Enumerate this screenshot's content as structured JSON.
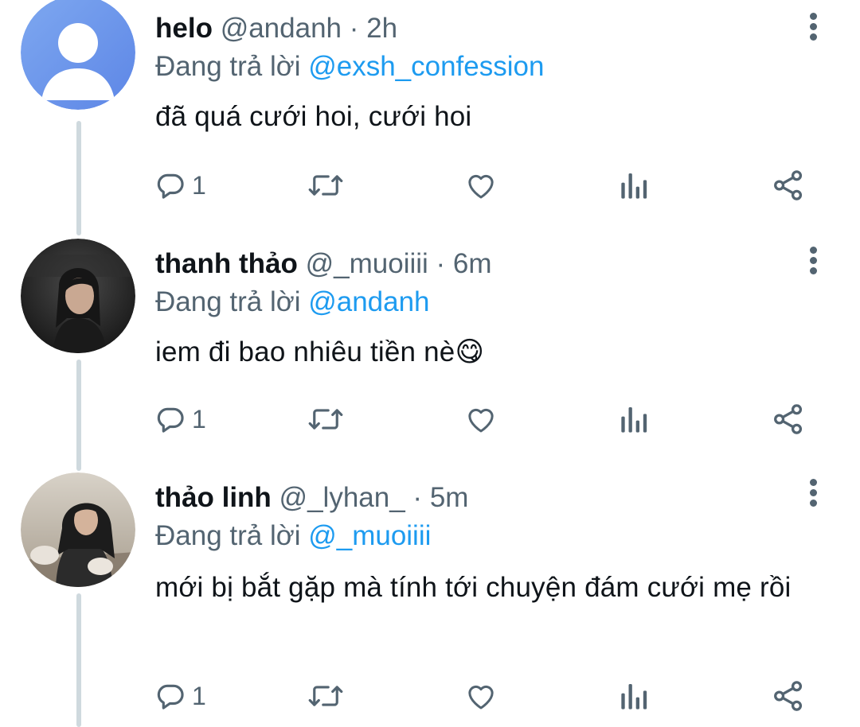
{
  "tweets": [
    {
      "display_name": "helo",
      "handle": "@andanh",
      "separator": "·",
      "time": "2h",
      "reply_prefix": "Đang trả lời",
      "reply_to": "@exsh_confession",
      "text": "đã quá cưới hoi, cưới hoi",
      "reply_count": "1",
      "avatar": "default-avatar"
    },
    {
      "display_name": "thanh thảo",
      "handle": "@_muoiiii",
      "separator": "·",
      "time": "6m",
      "reply_prefix": "Đang trả lời",
      "reply_to": "@andanh",
      "text": "iem đi bao nhiêu tiền nè😋",
      "reply_count": "1",
      "avatar": "photo-avatar"
    },
    {
      "display_name": "thảo linh",
      "handle": "@_lyhan_",
      "separator": "·",
      "time": "5m",
      "reply_prefix": "Đang trả lời",
      "reply_to": "@_muoiiii",
      "text": "mới bị bắt gặp mà tính tới chuyện đám cưới mẹ rồi",
      "reply_count": "1",
      "avatar": "photo-avatar"
    }
  ],
  "colors": {
    "text": "#0f1419",
    "secondary": "#536471",
    "link": "#1d9bf0",
    "thread_line": "#cfd9de"
  },
  "icons": [
    "reply-icon",
    "retweet-icon",
    "like-icon",
    "views-icon",
    "share-icon",
    "more-icon"
  ]
}
